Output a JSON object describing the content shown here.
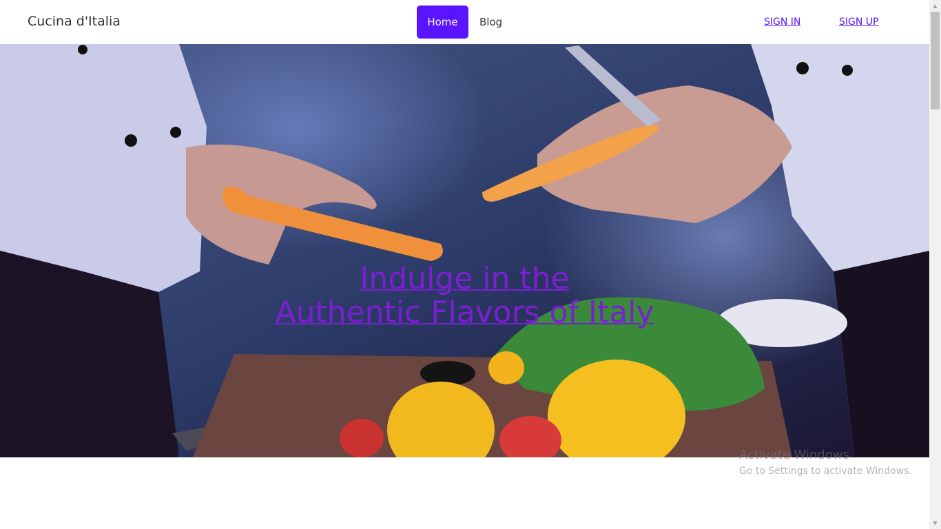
{
  "navbar": {
    "brand": "Cucina d'Italia",
    "links": {
      "home": "Home",
      "blog": "Blog"
    },
    "auth": {
      "sign_in": "SIGN IN",
      "sign_up": "SIGN UP"
    }
  },
  "hero": {
    "title_line1": "Indulge in the",
    "title_line2": "Authentic Flavors of Italy"
  },
  "watermark": {
    "title": "Activate Windows",
    "subtitle": "Go to Settings to activate Windows."
  },
  "colors": {
    "accent": "#5a14ff",
    "hero_title": "#7a1fd1"
  }
}
